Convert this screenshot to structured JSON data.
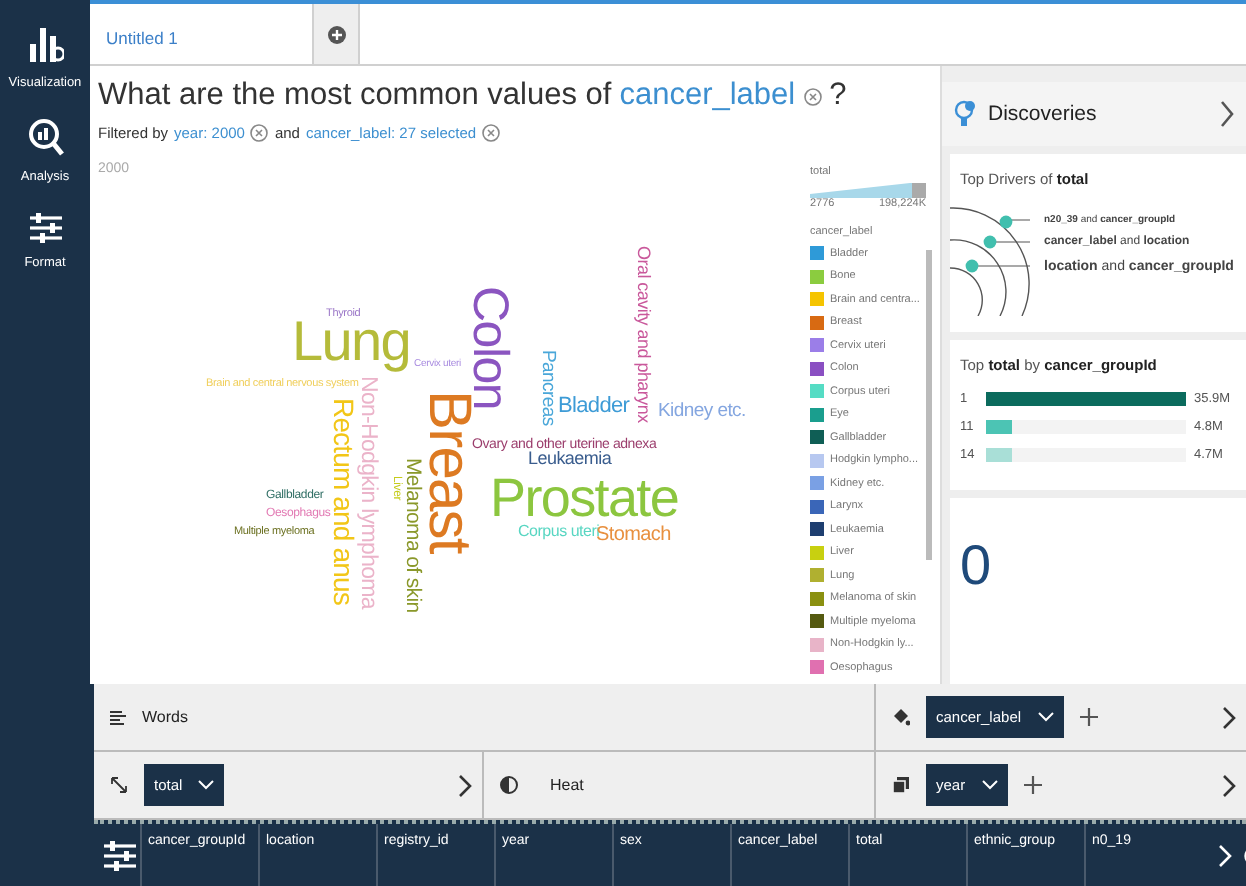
{
  "sidebar": {
    "items": [
      {
        "label": "Visualization",
        "kind": "chart"
      },
      {
        "label": "Analysis",
        "kind": "analysis"
      },
      {
        "label": "Format",
        "kind": "format"
      }
    ]
  },
  "tabs": [
    {
      "label": "Untitled 1",
      "selected": true
    }
  ],
  "question": {
    "prefix": "What are the most common values of",
    "field": "cancer_label",
    "suffix": "?"
  },
  "filters": {
    "label": "Filtered by",
    "joiner": "and",
    "items": [
      "year: 2000",
      "cancer_label: 27 selected"
    ]
  },
  "facet_label": "2000",
  "word_cloud": {
    "words": [
      {
        "text": "Oral cavity and pharynx",
        "color": "#c9589b",
        "kind": "vertical"
      },
      {
        "text": "Colon",
        "color": "#8b55c0",
        "kind": "vertical"
      },
      {
        "text": "Thyroid",
        "color": "#9c78c8",
        "kind": "horizontal"
      },
      {
        "text": "Lung",
        "color": "#b5bb3a",
        "kind": "horizontal"
      },
      {
        "text": "Pancreas",
        "color": "#4aa7d9",
        "kind": "vertical"
      },
      {
        "text": "Cervix uteri",
        "color": "#a98ce0",
        "kind": "horizontal"
      },
      {
        "text": "Non-Hodgkin lymphoma",
        "color": "#ebb3c9",
        "kind": "vertical"
      },
      {
        "text": "Brain and central nervous system",
        "color": "#f0cf5c",
        "kind": "horizontal"
      },
      {
        "text": "Breast",
        "color": "#dd7a22",
        "kind": "vertical"
      },
      {
        "text": "Rectum and anus",
        "color": "#f2c617",
        "kind": "vertical"
      },
      {
        "text": "Bladder",
        "color": "#3d9bd6",
        "kind": "horizontal"
      },
      {
        "text": "Kidney etc.",
        "color": "#84a6e0",
        "kind": "horizontal"
      },
      {
        "text": "Ovary and other uterine adnexa",
        "color": "#9b3d6c",
        "kind": "horizontal"
      },
      {
        "text": "Melanoma of skin",
        "color": "#8a982a",
        "kind": "vertical"
      },
      {
        "text": "Leukaemia",
        "color": "#3a5d8e",
        "kind": "horizontal"
      },
      {
        "text": "Liver",
        "color": "#c5cc1a",
        "kind": "vertical"
      },
      {
        "text": "Gallbladder",
        "color": "#2f6e64",
        "kind": "horizontal"
      },
      {
        "text": "Oesophagus",
        "color": "#e27ab3",
        "kind": "horizontal"
      },
      {
        "text": "Multiple myeloma",
        "color": "#6b7020",
        "kind": "horizontal"
      },
      {
        "text": "Prostate",
        "color": "#8cc63f",
        "kind": "horizontal"
      },
      {
        "text": "Corpus uteri",
        "color": "#58d6c2",
        "kind": "horizontal"
      },
      {
        "text": "Stomach",
        "color": "#e8903f",
        "kind": "horizontal"
      }
    ]
  },
  "legend": {
    "size_title": "total",
    "size_min": "2776",
    "size_max": "198,224K",
    "color_title": "cancer_label",
    "items": [
      {
        "label": "Bladder",
        "color": "#2e9ad8"
      },
      {
        "label": "Bone",
        "color": "#8bcc3f"
      },
      {
        "label": "Brain and centra...",
        "color": "#f5c400"
      },
      {
        "label": "Breast",
        "color": "#d86a12"
      },
      {
        "label": "Cervix uteri",
        "color": "#9b7ee8"
      },
      {
        "label": "Colon",
        "color": "#8a4fc2"
      },
      {
        "label": "Corpus uteri",
        "color": "#55dcc4"
      },
      {
        "label": "Eye",
        "color": "#1a9e8e"
      },
      {
        "label": "Gallbladder",
        "color": "#0f5e55"
      },
      {
        "label": "Hodgkin lympho...",
        "color": "#b7c8f0"
      },
      {
        "label": "Kidney etc.",
        "color": "#7aa0e4"
      },
      {
        "label": "Larynx",
        "color": "#3a66b8"
      },
      {
        "label": "Leukaemia",
        "color": "#1e3e70"
      },
      {
        "label": "Liver",
        "color": "#c8d010"
      },
      {
        "label": "Lung",
        "color": "#b0b030"
      },
      {
        "label": "Melanoma of skin",
        "color": "#8a9010"
      },
      {
        "label": "Multiple myeloma",
        "color": "#555a10"
      },
      {
        "label": "Non-Hodgkin ly...",
        "color": "#e8b4c8"
      },
      {
        "label": "Oesophagus",
        "color": "#e070b0"
      }
    ]
  },
  "discoveries": {
    "title": "Discoveries",
    "drivers": {
      "title": "Top Drivers of **total**",
      "items": [
        "**n20_39** and **cancer_groupId**",
        "**cancer_label** and **location**",
        "**location** and **cancer_groupId**"
      ]
    },
    "top": {
      "title": "Top **total** by **cancer_groupId**",
      "rows": [
        {
          "label": "1",
          "value": "35.9M",
          "level": 1,
          "color": "#0b6b5d"
        },
        {
          "label": "11",
          "value": "4.8M",
          "level": 0.13,
          "color": "#4cc4b4"
        },
        {
          "label": "14",
          "value": "4.7M",
          "level": 0.13,
          "color": "#a9dfd7"
        }
      ]
    },
    "count": "0"
  },
  "shelves": {
    "word": {
      "label": "Words"
    },
    "color": {
      "field": "cancer_label"
    },
    "size": {
      "field": "total"
    },
    "shading": {
      "label": "Heat"
    },
    "repeat": {
      "field": "year"
    }
  },
  "fields": [
    "cancer_groupId",
    "location",
    "registry_id",
    "year",
    "sex",
    "cancer_label",
    "total",
    "ethnic_group",
    "n0_19"
  ]
}
